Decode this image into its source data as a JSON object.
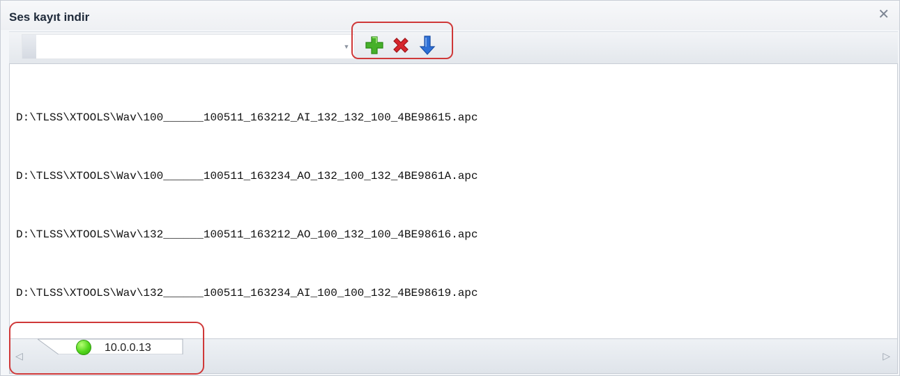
{
  "window": {
    "title": "Ses kayıt indir",
    "close_icon": "close-icon"
  },
  "toolbar": {
    "combo": {
      "value": "",
      "dropdown_icon": "chevron-down-icon"
    },
    "buttons": [
      {
        "icon": "plus-icon",
        "color": "#3fae22"
      },
      {
        "icon": "delete-icon",
        "color": "#d7262d"
      },
      {
        "icon": "arrow-down-icon",
        "color": "#2d6fd6"
      }
    ]
  },
  "files": [
    "D:\\TLSS\\XTOOLS\\Wav\\100______100511_163212_AI_132_132_100_4BE98615.apc",
    "D:\\TLSS\\XTOOLS\\Wav\\100______100511_163234_AO_132_100_132_4BE9861A.apc",
    "D:\\TLSS\\XTOOLS\\Wav\\132______100511_163212_AO_100_132_100_4BE98616.apc",
    "D:\\TLSS\\XTOOLS\\Wav\\132______100511_163234_AI_100_100_132_4BE98619.apc"
  ],
  "tabbar": {
    "nav_left_icon": "chevron-left-icon",
    "nav_right_icon": "chevron-right-icon",
    "tabs": [
      {
        "label": "10.0.0.13",
        "status_color": "#52d61b",
        "status_icon": "status-online-icon"
      }
    ]
  },
  "highlights": {
    "color": "#cf3838"
  }
}
